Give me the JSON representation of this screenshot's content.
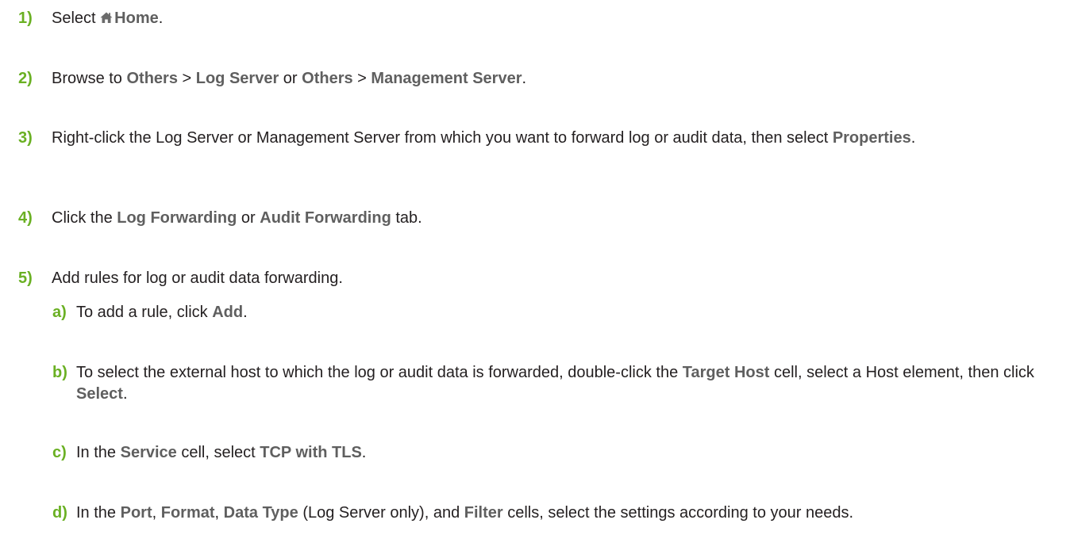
{
  "steps": [
    {
      "num": "1)",
      "parts": [
        "Select ",
        "Home",
        "."
      ]
    },
    {
      "num": "2)",
      "parts": [
        "Browse to ",
        "Others",
        " > ",
        "Log Server",
        " or ",
        "Others",
        " > ",
        "Management Server",
        "."
      ]
    },
    {
      "num": "3)",
      "parts": [
        "Right-click the Log Server or Management Server from which you want to forward log or audit data, then select ",
        "Properties",
        "."
      ]
    },
    {
      "num": "4)",
      "parts": [
        "Click the ",
        "Log Forwarding",
        " or ",
        "Audit Forwarding",
        " tab."
      ]
    },
    {
      "num": "5)",
      "parts": [
        "Add rules for log or audit data forwarding."
      ],
      "substeps": [
        {
          "num": "a)",
          "parts": [
            "To add a rule, click ",
            "Add",
            "."
          ]
        },
        {
          "num": "b)",
          "parts": [
            "To select the external host to which the log or audit data is forwarded, double-click the ",
            "Target Host",
            " cell, select a Host element, then click ",
            "Select",
            "."
          ]
        },
        {
          "num": "c)",
          "parts": [
            "In the ",
            "Service",
            " cell, select ",
            "TCP with TLS",
            "."
          ]
        },
        {
          "num": "d)",
          "parts": [
            "In the ",
            "Port",
            ", ",
            "Format",
            ", ",
            "Data Type",
            " (Log Server only), and ",
            "Filter",
            " cells, select the settings according to your needs."
          ]
        }
      ]
    }
  ],
  "icons": {
    "home": "home-icon"
  },
  "colors": {
    "step_number": "#6ab023",
    "ui_term": "#5f5f5f",
    "body_text": "#231f20"
  }
}
